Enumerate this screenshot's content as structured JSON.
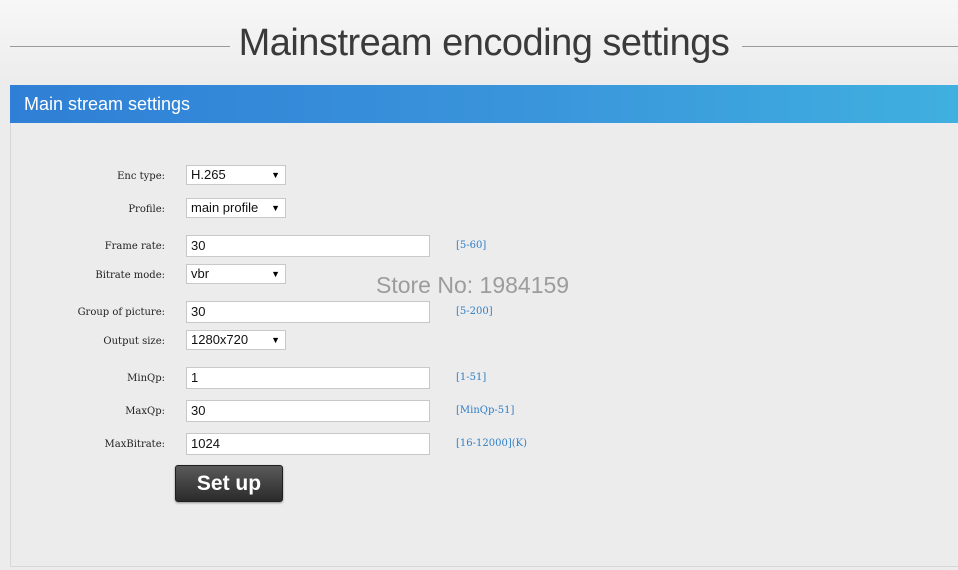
{
  "page_title": "Mainstream encoding settings",
  "section": {
    "title": "Main stream settings"
  },
  "form": {
    "enc_type": {
      "label": "Enc type:",
      "value": "H.265"
    },
    "profile": {
      "label": "Profile:",
      "value": "main profile"
    },
    "frame_rate": {
      "label": "Frame rate:",
      "value": "30",
      "hint": "[5-60]"
    },
    "bitrate_mode": {
      "label": "Bitrate mode:",
      "value": "vbr"
    },
    "gop": {
      "label": "Group of picture:",
      "value": "30",
      "hint": "[5-200]"
    },
    "output_size": {
      "label": "Output size:",
      "value": "1280x720"
    },
    "min_qp": {
      "label": "MinQp:",
      "value": "1",
      "hint": "[1-51]"
    },
    "max_qp": {
      "label": "MaxQp:",
      "value": "30",
      "hint": "[MinQp-51]"
    },
    "max_bitrate": {
      "label": "MaxBitrate:",
      "value": "1024",
      "hint": "[16-12000](K)"
    }
  },
  "setup_button_label": "Set up",
  "watermark": "Store No: 1984159",
  "colors": {
    "accent": "#3a95db",
    "hint": "#2f7fc8"
  },
  "icons": {
    "select_arrow": "chevron-down-icon"
  }
}
